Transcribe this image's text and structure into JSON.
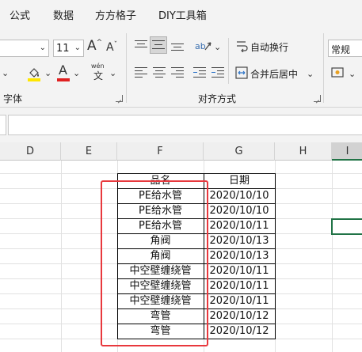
{
  "ribbon_tabs": [
    "公式",
    "数据",
    "方方格子",
    "DIY工具箱"
  ],
  "font": {
    "size_value": "11",
    "grow_glyph": "A",
    "shrink_glyph": "A",
    "grow_sup": "^",
    "shrink_sup": "ˇ",
    "font_color_glyph": "A",
    "phonetic_top": "wén",
    "phonetic_bottom": "文",
    "group_label": "字体",
    "highlight_color": "#ffe600",
    "font_color": "#e02020"
  },
  "alignment": {
    "wrap_text": "自动换行",
    "merge_center": "合并后居中",
    "group_label": "对齐方式"
  },
  "number": {
    "format_value": "常规"
  },
  "columns": [
    "D",
    "E",
    "F",
    "G",
    "H",
    "I"
  ],
  "table": {
    "headers": [
      "品名",
      "日期"
    ],
    "rows": [
      [
        "PE给水管",
        "2020/10/10"
      ],
      [
        "PE给水管",
        "2020/10/10"
      ],
      [
        "PE给水管",
        "2020/10/11"
      ],
      [
        "角阀",
        "2020/10/13"
      ],
      [
        "角阀",
        "2020/10/13"
      ],
      [
        "中空壁缠绕管",
        "2020/10/11"
      ],
      [
        "中空壁缠绕管",
        "2020/10/11"
      ],
      [
        "中空壁缠绕管",
        "2020/10/11"
      ],
      [
        "弯管",
        "2020/10/12"
      ],
      [
        "弯管",
        "2020/10/12"
      ]
    ]
  },
  "colors": {
    "annotation_red": "#e8383d",
    "selection_green": "#217346"
  }
}
